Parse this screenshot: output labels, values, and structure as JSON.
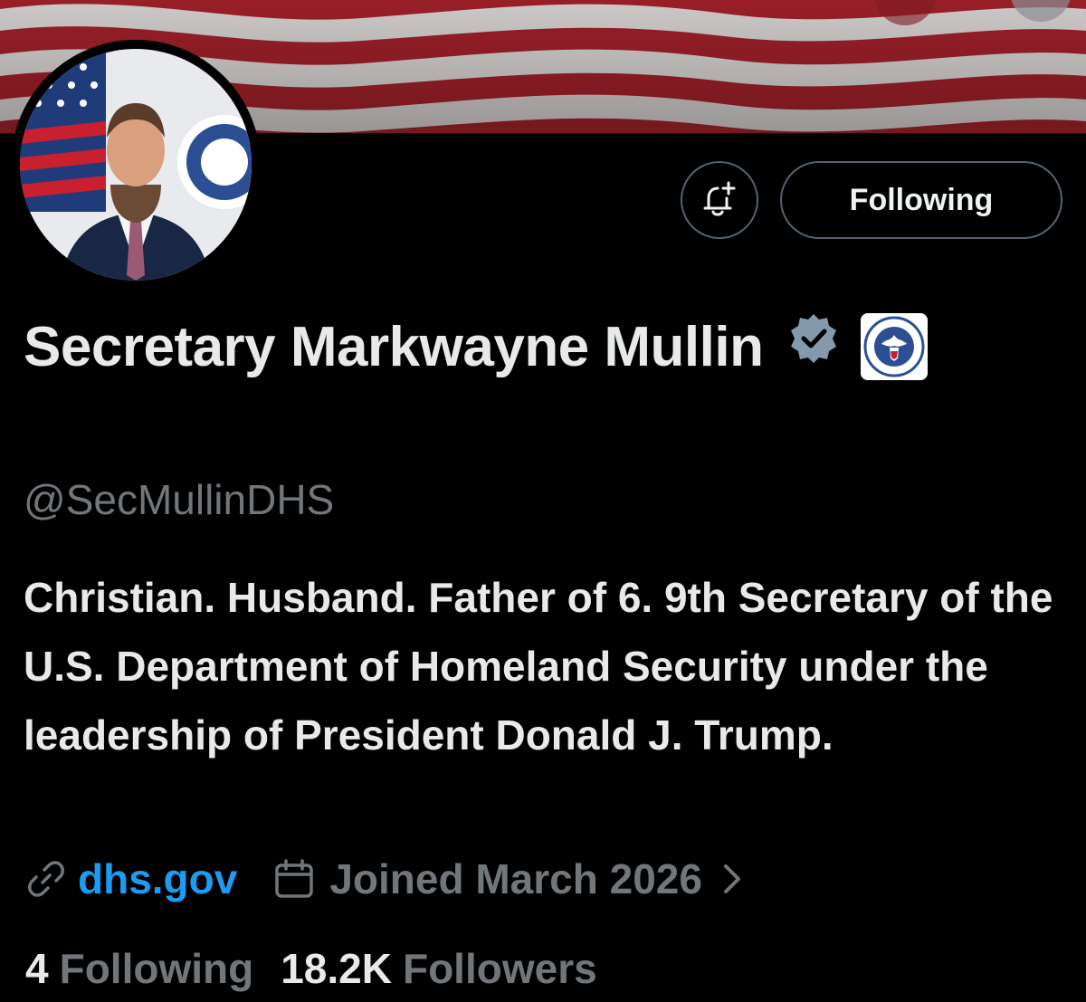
{
  "profile": {
    "display_name": "Secretary Markwayne Mullin",
    "handle": "@SecMullinDHS",
    "bio": "Christian. Husband. Father of 6. 9th Secretary of the U.S. Department of Homeland Security under the leadership of President Donald J. Trump.",
    "website": "dhs.gov",
    "joined": "Joined March 2026",
    "following_count": "4",
    "following_label": "Following",
    "followers_count": "18.2K",
    "followers_label": "Followers",
    "verified_badge_icon": "verified-badge-icon",
    "affiliation_badge_icon": "dhs-seal-icon"
  },
  "actions": {
    "notify_icon": "bell-plus-icon",
    "follow_state_label": "Following"
  },
  "colors": {
    "background": "#000000",
    "link": "#1d9bf0",
    "secondary_text": "#71767b",
    "primary_text": "#e7e9ea",
    "verified_badge": "#829aab",
    "button_border": "#536471"
  }
}
